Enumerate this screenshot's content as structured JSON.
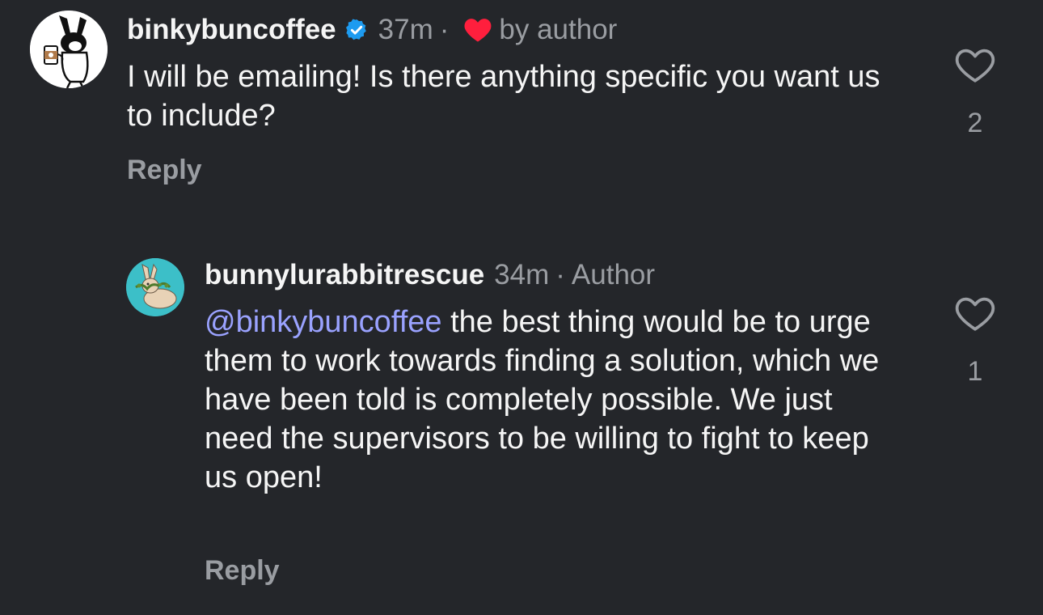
{
  "comments": [
    {
      "username": "binkybuncoffee",
      "verified": true,
      "time": "37m",
      "separator": "·",
      "liked_by_author_label": "by author",
      "text": "I will be emailing! Is there anything specific you want us to include?",
      "reply_label": "Reply",
      "like_count": "2",
      "avatar_icon": "rabbit-holding-coffee-icon"
    },
    {
      "username": "bunnylurabbitrescue",
      "time": "34m",
      "separator": "·",
      "author_label": "Author",
      "mention": "@binkybuncoffee",
      "text": " the best thing would be to urge them to work towards finding a solution, which we have been told is completely possible. We just need the supervisors to be willing to fight to keep us open!",
      "reply_label": "Reply",
      "like_count": "1",
      "avatar_icon": "rabbit-with-greens-icon"
    }
  ],
  "colors": {
    "background": "#24262a",
    "text": "#f5f5f5",
    "muted": "#9a9da2",
    "mention": "#9aa2ff",
    "verified": "#1d9bf0",
    "heart": "#ff1f3d"
  }
}
